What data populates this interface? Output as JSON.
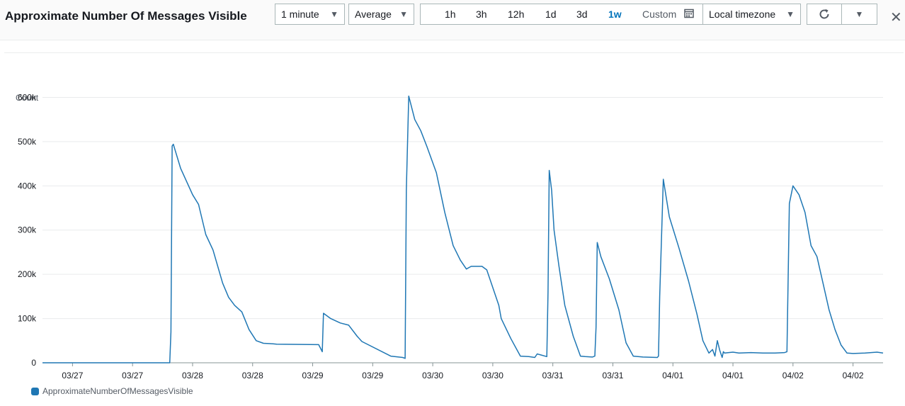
{
  "header": {
    "title": "Approximate Number Of Messages Visible",
    "period": "1 minute",
    "statistic": "Average",
    "ranges": [
      "1h",
      "3h",
      "12h",
      "1d",
      "3d",
      "1w"
    ],
    "active_range": "1w",
    "custom_label": "Custom",
    "timezone": "Local timezone"
  },
  "icons": {
    "calendar": "calendar-icon",
    "refresh": "refresh-icon",
    "dropdown": "caret-down-icon",
    "close": "close-icon"
  },
  "colors": {
    "series": "#1f77b4",
    "active": "#0073bb"
  },
  "chart_data": {
    "type": "line",
    "title": "",
    "ylabel": "Count",
    "ylim": [
      0,
      620000
    ],
    "yticks": [
      0,
      100000,
      200000,
      300000,
      400000,
      500000,
      600000
    ],
    "ytick_labels": [
      "0",
      "100k",
      "200k",
      "300k",
      "400k",
      "500k",
      "600k"
    ],
    "xlim": [
      0.0,
      7.0
    ],
    "xticks": [
      0.25,
      0.75,
      1.25,
      1.75,
      2.25,
      2.75,
      3.25,
      3.75,
      4.25,
      4.75,
      5.25,
      5.75,
      6.25,
      6.75
    ],
    "xtick_labels": [
      "03/27",
      "03/27",
      "03/28",
      "03/28",
      "03/29",
      "03/29",
      "03/30",
      "03/30",
      "03/31",
      "03/31",
      "04/01",
      "04/01",
      "04/02",
      "04/02"
    ],
    "grid": true,
    "legend": "bottom-left",
    "series": [
      {
        "name": "ApproximateNumberOfMessagesVisible",
        "color": "#1f77b4",
        "x": [
          0.0,
          1.0,
          1.06,
          1.07,
          1.08,
          1.09,
          1.1,
          1.15,
          1.25,
          1.3,
          1.36,
          1.42,
          1.5,
          1.55,
          1.6,
          1.66,
          1.72,
          1.78,
          1.84,
          1.92,
          1.95,
          2.3,
          2.33,
          2.34,
          2.4,
          2.48,
          2.55,
          2.62,
          2.66,
          2.9,
          3.0,
          3.02,
          3.03,
          3.05,
          3.1,
          3.15,
          3.2,
          3.28,
          3.35,
          3.42,
          3.48,
          3.53,
          3.57,
          3.6,
          3.63,
          3.66,
          3.7,
          3.8,
          3.82,
          3.9,
          3.98,
          4.05,
          4.1,
          4.12,
          4.2,
          4.21,
          4.22,
          4.24,
          4.26,
          4.3,
          4.35,
          4.42,
          4.48,
          4.52,
          4.58,
          4.6,
          4.61,
          4.62,
          4.65,
          4.72,
          4.8,
          4.86,
          4.92,
          5.0,
          5.12,
          5.13,
          5.14,
          5.17,
          5.22,
          5.3,
          5.38,
          5.45,
          5.5,
          5.55,
          5.58,
          5.6,
          5.62,
          5.64,
          5.66,
          5.67,
          5.68,
          5.75,
          5.8,
          5.9,
          6.0,
          6.1,
          6.18,
          6.2,
          6.22,
          6.25,
          6.3,
          6.35,
          6.4,
          6.45,
          6.5,
          6.55,
          6.6,
          6.65,
          6.7,
          6.75,
          6.85,
          6.95,
          7.0
        ],
        "y": [
          0,
          0,
          0,
          70000,
          490000,
          494000,
          485000,
          440000,
          380000,
          358000,
          290000,
          255000,
          180000,
          148000,
          130000,
          115000,
          75000,
          50000,
          44000,
          43000,
          42000,
          41000,
          25000,
          112000,
          100000,
          90000,
          85000,
          60000,
          48000,
          15000,
          12000,
          10000,
          390000,
          603000,
          550000,
          525000,
          490000,
          430000,
          340000,
          265000,
          232000,
          212000,
          218000,
          218000,
          218000,
          218000,
          210000,
          130000,
          100000,
          55000,
          15000,
          14000,
          12000,
          20000,
          14000,
          160000,
          435000,
          390000,
          300000,
          220000,
          130000,
          60000,
          15000,
          14000,
          13000,
          15000,
          80000,
          272000,
          240000,
          190000,
          120000,
          45000,
          15000,
          13000,
          12000,
          15000,
          150000,
          415000,
          330000,
          260000,
          185000,
          110000,
          50000,
          22000,
          30000,
          15000,
          50000,
          28000,
          12000,
          25000,
          22000,
          24000,
          22000,
          23000,
          22000,
          22000,
          23000,
          25000,
          360000,
          400000,
          380000,
          340000,
          265000,
          240000,
          180000,
          120000,
          75000,
          40000,
          22000,
          21000,
          22000,
          24000,
          22000
        ]
      }
    ]
  }
}
